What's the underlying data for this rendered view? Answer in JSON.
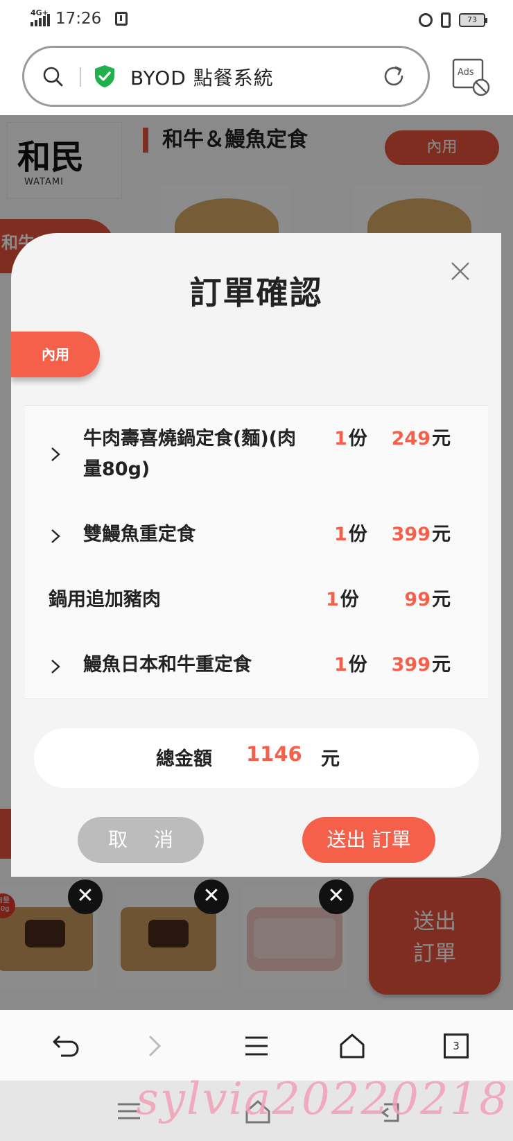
{
  "status_bar": {
    "time": "17:26",
    "network": "4G+",
    "battery": "73",
    "icons": [
      "signal-icon",
      "notification-icon",
      "alarm-icon",
      "vibrate-icon",
      "battery-icon"
    ]
  },
  "browser": {
    "url_title": "BYOD 點餐系統",
    "ads_label": "Ads",
    "icons": [
      "search-icon",
      "secure-shield-icon",
      "reload-icon",
      "ads-block-icon"
    ]
  },
  "background": {
    "logo_text": "和民",
    "logo_sub": "WATAMI",
    "category_title": "和牛＆鰻魚定食",
    "dine_in": "內用",
    "side_tab": "和牛",
    "cart_badge": "肉量 80g",
    "submit_order": [
      "送出",
      "訂單"
    ],
    "remove_symbol": "✕"
  },
  "modal": {
    "title": "訂單確認",
    "close_symbol": "×",
    "dine_in_tag": "內用",
    "items": [
      {
        "name_line1": "牛肉壽喜燒鍋定食(麵)(肉",
        "name_line2": "量80g)",
        "qty": "1",
        "qty_unit": "份",
        "price": "249",
        "price_unit": "元",
        "expandable": true
      },
      {
        "name_line1": "雙鰻魚重定食",
        "name_line2": "",
        "qty": "1",
        "qty_unit": "份",
        "price": "399",
        "price_unit": "元",
        "expandable": true
      },
      {
        "name_line1": "鍋用追加豬肉",
        "name_line2": "",
        "qty": "1",
        "qty_unit": "份",
        "price": "99",
        "price_unit": "元",
        "expandable": false
      },
      {
        "name_line1": "鰻魚日本和牛重定食",
        "name_line2": "",
        "qty": "1",
        "qty_unit": "份",
        "price": "399",
        "price_unit": "元",
        "expandable": true
      }
    ],
    "total_label": "總金額",
    "total_value": "1146",
    "total_unit": "元",
    "cancel_label": "取消",
    "send_label": "送出 訂單"
  },
  "bottom_nav": {
    "tab_count": "3",
    "icons": [
      "back-icon",
      "forward-icon",
      "menu-icon",
      "home-icon",
      "tabs-icon"
    ]
  },
  "system_nav": {
    "icons": [
      "recent-apps-icon",
      "home-icon",
      "back-icon"
    ]
  },
  "watermark": "sylvia20220218",
  "colors": {
    "accent": "#f5604a",
    "brand_red": "#e8523c",
    "secure_green": "#20b14c"
  }
}
